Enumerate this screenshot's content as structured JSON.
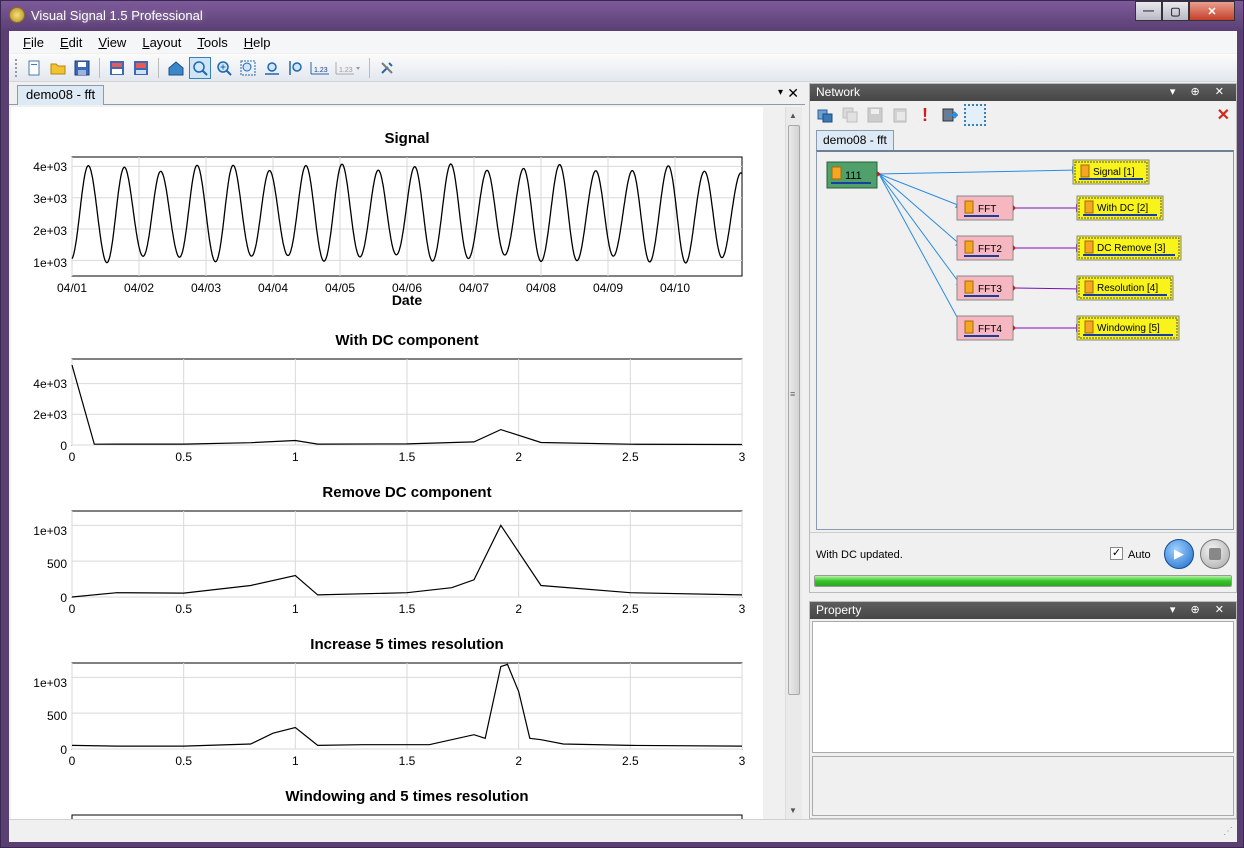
{
  "window": {
    "title": "Visual Signal 1.5 Professional",
    "min_label": "—",
    "max_label": "▢",
    "close_label": "✕"
  },
  "menu": {
    "file": "F",
    "file_rest": "ile",
    "edit": "E",
    "edit_rest": "dit",
    "view": "V",
    "view_rest": "iew",
    "layout": "L",
    "layout_rest": "ayout",
    "tools": "T",
    "tools_rest": "ools",
    "help": "H",
    "help_rest": "elp"
  },
  "toolbar": {
    "icons": [
      "new-icon",
      "open-icon",
      "save-icon",
      "save-all-icon",
      "print-icon",
      "home-icon",
      "zoom-icon",
      "zoom-in-icon",
      "zoom-fit-icon",
      "zoom-x-icon",
      "zoom-y-icon",
      "decimal-icon",
      "decimal-options-icon",
      "settings-icon"
    ]
  },
  "document": {
    "tab_label": "demo08 - fft",
    "menu_glyph": "▾",
    "close_glyph": "✕"
  },
  "charts": {
    "signal": {
      "title": "Signal",
      "xlabel": "Date",
      "yticks": [
        "1e+03",
        "2e+03",
        "3e+03",
        "4e+03"
      ],
      "xticks": [
        "04/01",
        "04/02",
        "04/03",
        "04/04",
        "04/05",
        "04/06",
        "04/07",
        "04/08",
        "04/09",
        "04/10"
      ]
    },
    "with_dc": {
      "title": "With DC component",
      "yticks": [
        "0",
        "2e+03",
        "4e+03"
      ],
      "xticks": [
        "0",
        "0.5",
        "1",
        "1.5",
        "2",
        "2.5",
        "3"
      ]
    },
    "remove_dc": {
      "title": "Remove DC component",
      "yticks": [
        "0",
        "500",
        "1e+03"
      ],
      "xticks": [
        "0",
        "0.5",
        "1",
        "1.5",
        "2",
        "2.5",
        "3"
      ]
    },
    "resolution": {
      "title": "Increase 5 times resolution",
      "yticks": [
        "0",
        "500",
        "1e+03"
      ],
      "xticks": [
        "0",
        "0.5",
        "1",
        "1.5",
        "2",
        "2.5",
        "3"
      ]
    },
    "windowing": {
      "title": "Windowing and 5 times resolution"
    }
  },
  "chart_data": [
    {
      "type": "line",
      "title": "Signal",
      "xlabel": "Date",
      "ylabel": "",
      "x": [
        "04/01",
        "04/02",
        "04/03",
        "04/04",
        "04/05",
        "04/06",
        "04/07",
        "04/08",
        "04/09",
        "04/10"
      ],
      "ylim": [
        500,
        4300
      ],
      "cycles_per_day": 1.85,
      "amplitude_range": [
        1000,
        3900
      ],
      "grid": true
    },
    {
      "type": "line",
      "title": "With DC component",
      "xlim": [
        0,
        3
      ],
      "ylim": [
        0,
        5600
      ],
      "x": [
        0,
        0.1,
        0.2,
        0.5,
        0.8,
        1.0,
        1.1,
        1.5,
        1.8,
        1.92,
        2.1,
        2.5,
        3.0
      ],
      "values": [
        5200,
        50,
        60,
        60,
        150,
        290,
        60,
        70,
        200,
        1000,
        160,
        50,
        30
      ],
      "grid": true
    },
    {
      "type": "line",
      "title": "Remove DC component",
      "xlim": [
        0,
        3
      ],
      "ylim": [
        0,
        1200
      ],
      "x": [
        0,
        0.2,
        0.5,
        0.8,
        1.0,
        1.1,
        1.5,
        1.7,
        1.8,
        1.92,
        2.1,
        2.5,
        3.0
      ],
      "values": [
        0,
        60,
        55,
        160,
        300,
        30,
        60,
        130,
        240,
        1000,
        160,
        60,
        30
      ],
      "grid": true
    },
    {
      "type": "line",
      "title": "Increase 5 times resolution",
      "xlim": [
        0,
        3
      ],
      "ylim": [
        0,
        1200
      ],
      "x": [
        0,
        0.2,
        0.5,
        0.8,
        0.9,
        1.0,
        1.1,
        1.3,
        1.6,
        1.8,
        1.85,
        1.92,
        1.95,
        2.0,
        2.05,
        2.1,
        2.2,
        2.5,
        3.0
      ],
      "values": [
        50,
        40,
        40,
        70,
        220,
        300,
        50,
        60,
        60,
        200,
        150,
        1150,
        1180,
        800,
        150,
        130,
        70,
        50,
        40
      ],
      "grid": true
    }
  ],
  "network": {
    "panel_title": "Network",
    "tab_label": "demo08 - fft",
    "toolbar_icons": [
      "add-node-icon",
      "copy-node-icon",
      "save-node-icon",
      "paste-node-icon",
      "alert-icon",
      "export-icon",
      "select-icon"
    ],
    "source": "111",
    "fft_nodes": [
      "FFT",
      "FFT2",
      "FFT3",
      "FFT4"
    ],
    "outputs": [
      "Signal [1]",
      "With DC [2]",
      "DC Remove [3]",
      "Resolution [4]",
      "Windowing [5]"
    ],
    "colors": {
      "source": "#4fa06a",
      "fft": "#f6b7c1",
      "output": "#f7f31b",
      "edge_source": "#2b8ce0",
      "edge_fft": "#7a10b0"
    }
  },
  "status": {
    "message": "With DC updated.",
    "auto_label": "Auto",
    "auto_checked": "✓",
    "progress_fraction": 1.0
  },
  "property": {
    "panel_title": "Property"
  }
}
